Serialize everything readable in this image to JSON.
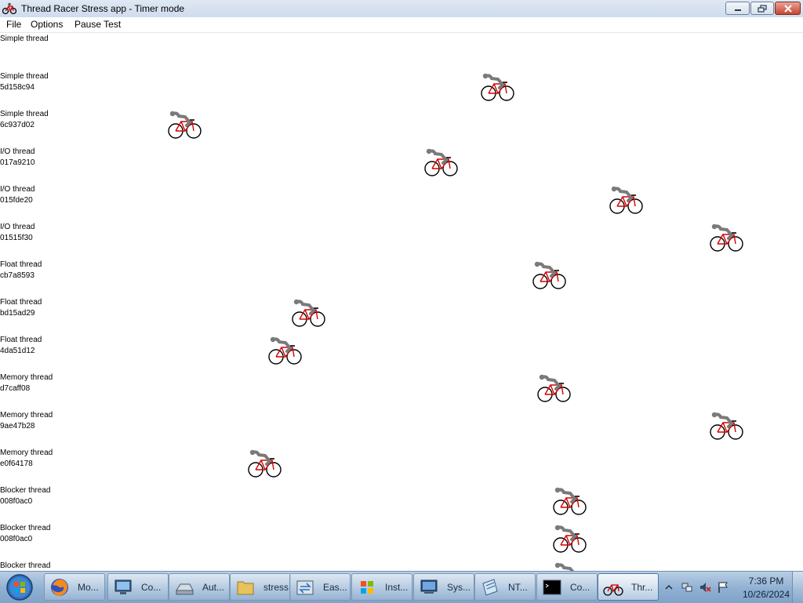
{
  "window": {
    "title": "Thread Racer Stress app - Timer mode",
    "title_icon": "bicycle-icon"
  },
  "menu": [
    "File",
    "Options",
    "Pause Test"
  ],
  "lanes": [
    {
      "name": "Simple thread",
      "id": "",
      "progress": null
    },
    {
      "name": "Simple thread",
      "id": "5d158c94",
      "progress": 0.62
    },
    {
      "name": "Simple thread",
      "id": "6c937d02",
      "progress": 0.23
    },
    {
      "name": "I/O thread",
      "id": "017a9210",
      "progress": 0.55
    },
    {
      "name": "I/O thread",
      "id": "015fde20",
      "progress": 0.78
    },
    {
      "name": "I/O thread",
      "id": "01515f30",
      "progress": 0.905
    },
    {
      "name": "Float thread",
      "id": "cb7a8593",
      "progress": 0.685
    },
    {
      "name": "Float thread",
      "id": "bd15ad29",
      "progress": 0.385
    },
    {
      "name": "Float thread",
      "id": "4da51d12",
      "progress": 0.355
    },
    {
      "name": "Memory thread",
      "id": "d7caff08",
      "progress": 0.69
    },
    {
      "name": "Memory thread",
      "id": "9ae47b28",
      "progress": 0.905
    },
    {
      "name": "Memory thread",
      "id": "e0f64178",
      "progress": 0.33
    },
    {
      "name": "Blocker thread",
      "id": "008f0ac0",
      "progress": 0.71
    },
    {
      "name": "Blocker thread",
      "id": "008f0ac0",
      "progress": 0.71
    },
    {
      "name": "Blocker thread",
      "id": "",
      "progress": 0.71
    }
  ],
  "taskbar": {
    "start_icon": "windows-orb-icon",
    "tasks": [
      {
        "label": "Mo...",
        "icon": "firefox-icon"
      },
      {
        "label": "Co...",
        "icon": "computer-icon"
      },
      {
        "label": "Aut...",
        "icon": "drive-icon"
      },
      {
        "label": "stress",
        "icon": "folder-icon"
      },
      {
        "label": "Eas...",
        "icon": "transfer-icon"
      },
      {
        "label": "Inst...",
        "icon": "windows-flag-icon"
      },
      {
        "label": "Sys...",
        "icon": "system-icon"
      },
      {
        "label": "NT...",
        "icon": "notepad-icon"
      },
      {
        "label": "Co...",
        "icon": "console-icon"
      },
      {
        "label": "Thr...",
        "icon": "bicycle-icon"
      }
    ],
    "clock": {
      "time": "7:36 PM",
      "date": "10/26/2024"
    }
  }
}
